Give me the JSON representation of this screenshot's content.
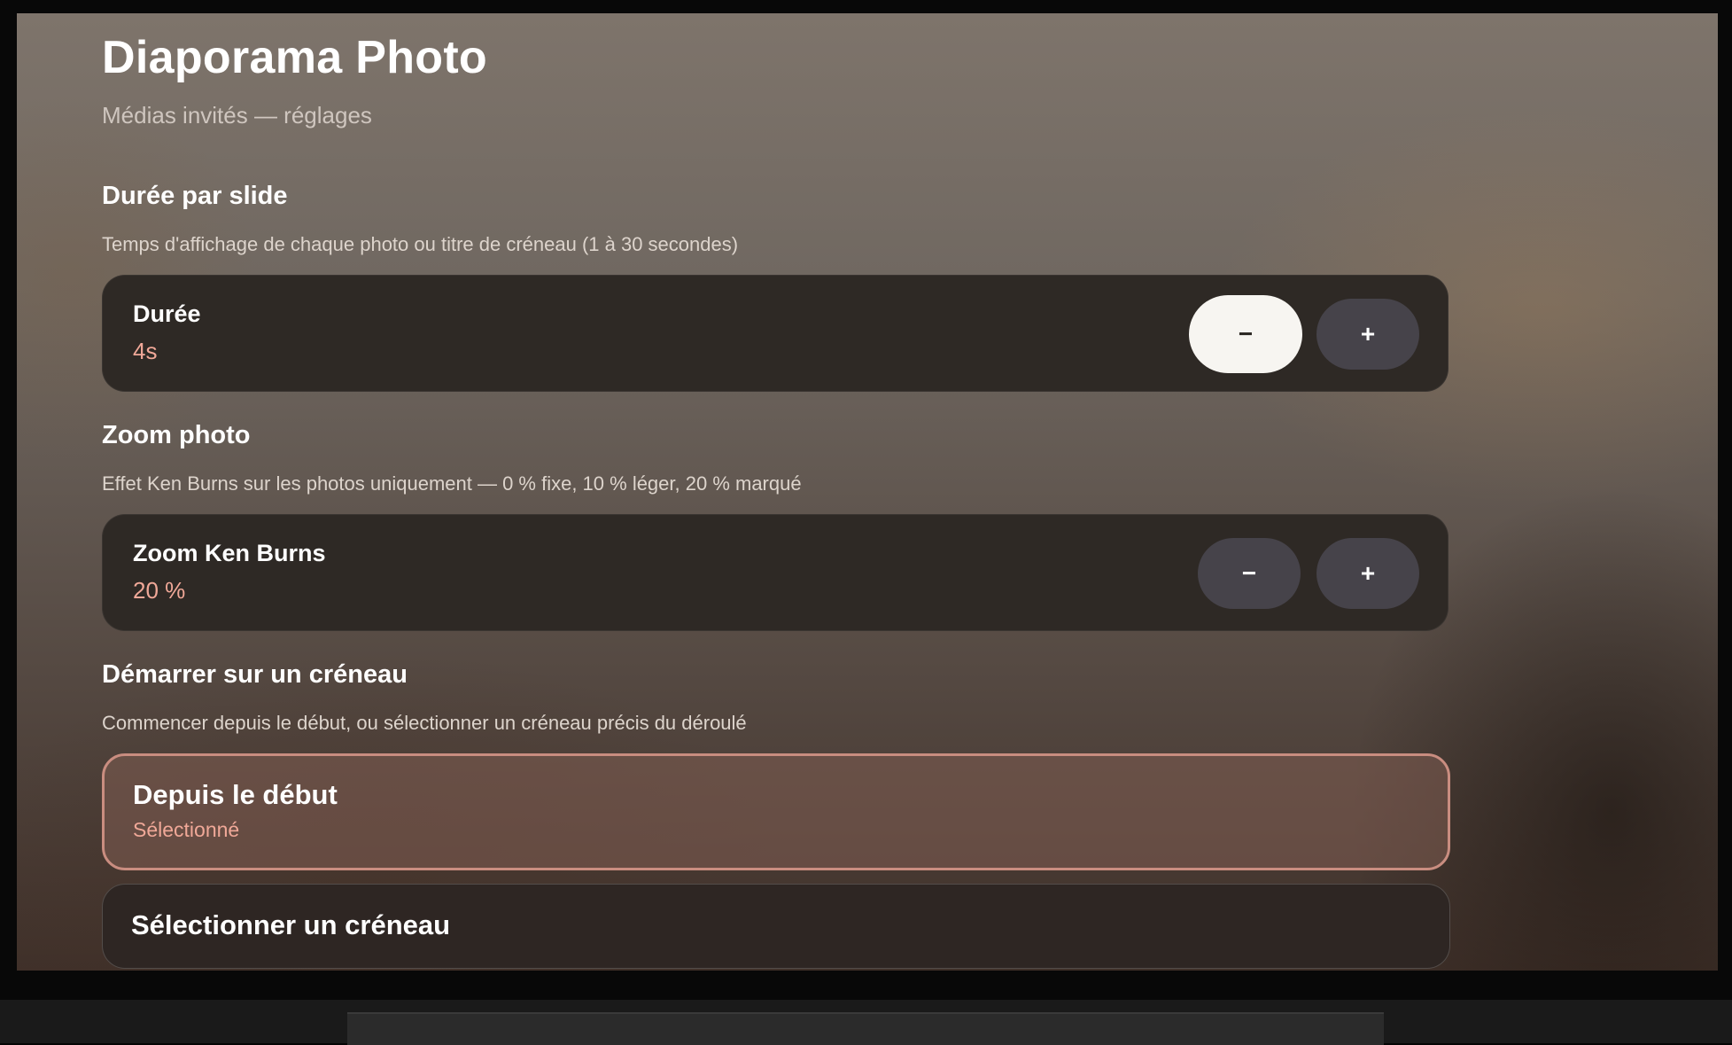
{
  "app": {
    "title": "Diaporama Photo",
    "subtitle": "Médias invités — réglages"
  },
  "sections": {
    "duration": {
      "title": "Durée par slide",
      "description": "Temps d'affichage de chaque photo ou titre de créneau (1 à 30 secondes)",
      "card_label": "Durée",
      "card_value": "4s",
      "decrease_label": "−",
      "increase_label": "+"
    },
    "zoom": {
      "title": "Zoom photo",
      "description": "Effet Ken Burns sur les photos uniquement — 0 % fixe, 10 % léger, 20 % marqué",
      "card_label": "Zoom Ken Burns",
      "card_value": "20 %",
      "decrease_label": "−",
      "increase_label": "+"
    },
    "start": {
      "title": "Démarrer sur un créneau",
      "description": "Commencer depuis le début, ou sélectionner un créneau précis du déroulé",
      "options": [
        {
          "label": "Depuis le début",
          "status": "Sélectionné",
          "selected": true
        },
        {
          "label": "Sélectionner un créneau",
          "selected": false
        }
      ]
    }
  },
  "colors": {
    "accent": "#f0a898",
    "card_background": "#2e2925",
    "focused_button": "#f7f5f1",
    "button_background": "#46434a",
    "selected_border": "#c98d80"
  }
}
